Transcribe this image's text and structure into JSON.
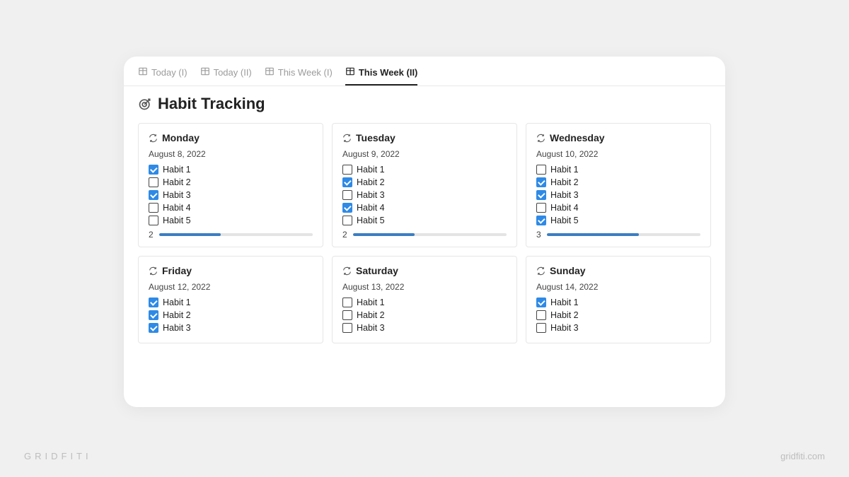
{
  "footer": {
    "brand": "GRIDFITI",
    "url": "gridfiti.com"
  },
  "tabs": [
    {
      "label": "Today (I)",
      "active": false
    },
    {
      "label": "Today (II)",
      "active": false
    },
    {
      "label": "This Week (I)",
      "active": false
    },
    {
      "label": "This Week (II)",
      "active": true
    }
  ],
  "title": "Habit Tracking",
  "cards": [
    {
      "day": "Monday",
      "date": "August 8, 2022",
      "habits": [
        {
          "label": "Habit 1",
          "checked": true
        },
        {
          "label": "Habit 2",
          "checked": false
        },
        {
          "label": "Habit 3",
          "checked": true
        },
        {
          "label": "Habit 4",
          "checked": false
        },
        {
          "label": "Habit 5",
          "checked": false
        }
      ],
      "count": "2",
      "progress": 40
    },
    {
      "day": "Tuesday",
      "date": "August 9, 2022",
      "habits": [
        {
          "label": "Habit 1",
          "checked": false
        },
        {
          "label": "Habit 2",
          "checked": true
        },
        {
          "label": "Habit 3",
          "checked": false
        },
        {
          "label": "Habit 4",
          "checked": true
        },
        {
          "label": "Habit 5",
          "checked": false
        }
      ],
      "count": "2",
      "progress": 40
    },
    {
      "day": "Wednesday",
      "date": "August 10, 2022",
      "habits": [
        {
          "label": "Habit 1",
          "checked": false
        },
        {
          "label": "Habit 2",
          "checked": true
        },
        {
          "label": "Habit 3",
          "checked": true
        },
        {
          "label": "Habit 4",
          "checked": false
        },
        {
          "label": "Habit 5",
          "checked": true
        }
      ],
      "count": "3",
      "progress": 60
    },
    {
      "day": "Friday",
      "date": "August 12, 2022",
      "habits": [
        {
          "label": "Habit 1",
          "checked": true
        },
        {
          "label": "Habit 2",
          "checked": true
        },
        {
          "label": "Habit 3",
          "checked": true
        }
      ],
      "count": null,
      "progress": null
    },
    {
      "day": "Saturday",
      "date": "August 13, 2022",
      "habits": [
        {
          "label": "Habit 1",
          "checked": false
        },
        {
          "label": "Habit 2",
          "checked": false
        },
        {
          "label": "Habit 3",
          "checked": false
        }
      ],
      "count": null,
      "progress": null
    },
    {
      "day": "Sunday",
      "date": "August 14, 2022",
      "habits": [
        {
          "label": "Habit 1",
          "checked": true
        },
        {
          "label": "Habit 2",
          "checked": false
        },
        {
          "label": "Habit 3",
          "checked": false
        }
      ],
      "count": null,
      "progress": null
    }
  ]
}
